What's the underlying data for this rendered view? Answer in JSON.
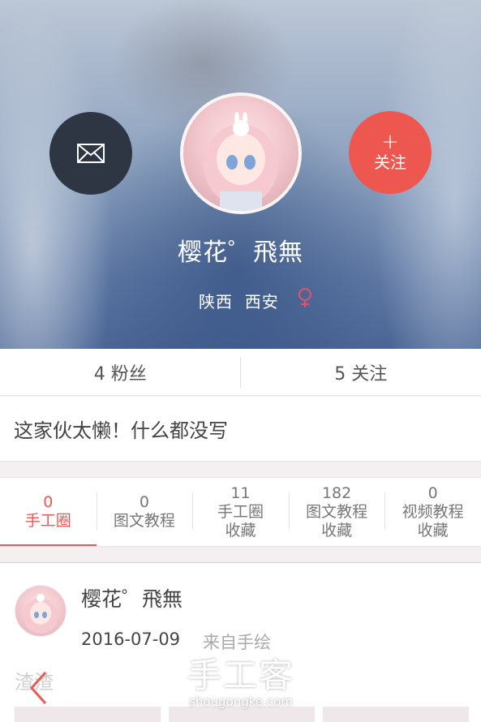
{
  "profile": {
    "name": "樱花゜飛無",
    "location_province": "陕西",
    "location_city": "西安",
    "follow_label": "关注",
    "follow_plus": "+"
  },
  "stats": {
    "fans": "4 粉丝",
    "following": "5 关注"
  },
  "bio": "这家伙太懒！什么都没写",
  "tabs": [
    {
      "count": "0",
      "label": "手工圈",
      "active": true
    },
    {
      "count": "0",
      "label": "图文教程",
      "active": false
    },
    {
      "count": "11",
      "label": "手工圈",
      "label2": "收藏",
      "active": false
    },
    {
      "count": "182",
      "label": "图文教程",
      "label2": "收藏",
      "active": false
    },
    {
      "count": "0",
      "label": "视频教程",
      "label2": "收藏",
      "active": false
    }
  ],
  "post": {
    "author": "樱花゜飛無",
    "date": "2016-07-09",
    "source": "来自手绘",
    "text": "渣渣"
  },
  "watermark": {
    "title": "手工客",
    "url": "shougongke.com"
  },
  "colors": {
    "accent": "#e95a55",
    "follow_button": "#ee5650",
    "message_button": "#2e3644",
    "gender_female": "#e8506a"
  },
  "icons": {
    "message": "envelope-icon",
    "gender": "female-icon",
    "back": "chevron-left-icon"
  }
}
